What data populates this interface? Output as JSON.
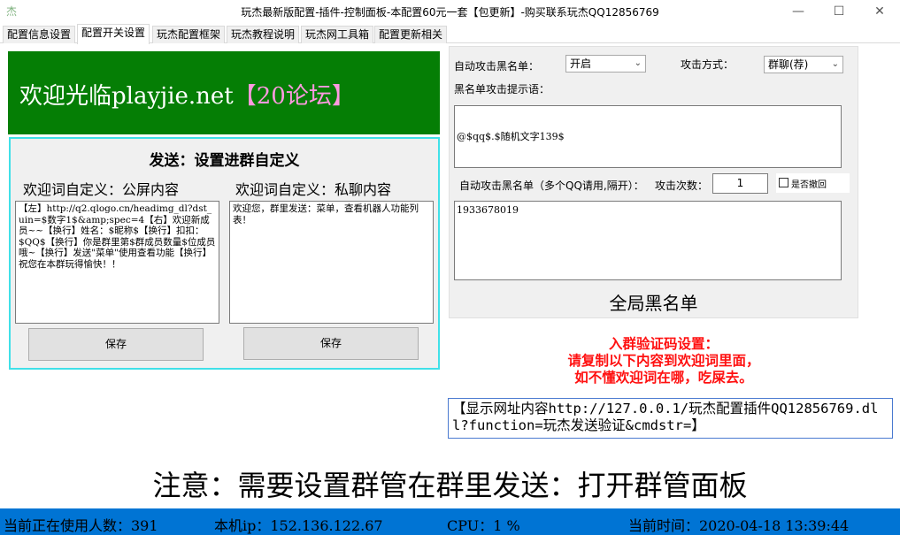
{
  "window": {
    "title": "玩杰最新版配置-插件-控制面板-本配置60元一套【包更新】-购买联系玩杰QQ12856769",
    "app_icon": "杰"
  },
  "tabs": [
    {
      "label": "配置信息设置",
      "active": false
    },
    {
      "label": "配置开关设置",
      "active": true
    },
    {
      "label": "玩杰配置框架",
      "active": false
    },
    {
      "label": "玩杰教程说明",
      "active": false
    },
    {
      "label": "玩杰网工具箱",
      "active": false
    },
    {
      "label": "配置更新相关",
      "active": false
    }
  ],
  "banner": {
    "text_main": "欢迎光临playjie.net",
    "text_pink": "【20论坛】",
    "bg_color": "#057e05"
  },
  "send_panel": {
    "title": "发送：设置进群自定义",
    "public_label": "欢迎词自定义：公屏内容",
    "private_label": "欢迎词自定义：私聊内容",
    "public_content": "【左】http://q2.qlogo.cn/headimg_dl?dst_uin=$数字1$&amp;spec=4【右】欢迎新成员~~【换行】姓名：$昵称$【换行】扣扣：$QQ$【换行】你是群里第$群成员数量$位成员哦~【换行】发送\"菜单\"使用查看功能【换行】祝您在本群玩得愉快！！",
    "private_content": "欢迎您，群里发送：菜单，查看机器人功能列表！",
    "save_left": "保存",
    "save_right": "保存"
  },
  "right_panel": {
    "auto_attack_label": "自动攻击黑名单：",
    "auto_attack_value": "开启",
    "attack_mode_label": "攻击方式：",
    "attack_mode_value": "群聊(荐)",
    "tip_label": "黑名单攻击提示语：",
    "tip_content": "@$qq$.$随机文字139$",
    "blacklist_label": "自动攻击黑名单（多个QQ请用,隔开）：",
    "attack_count_label": "攻击次数：",
    "attack_count_value": "1",
    "recall_label": "是否撤回",
    "blacklist_content": "1933678019",
    "global_label": "全局黑名单"
  },
  "verify": {
    "line1": "入群验证码设置：",
    "line2": "请复制以下内容到欢迎词里面，",
    "line3": "如不懂欢迎词在哪，吃屎去。",
    "content": "【显示网址内容http://127.0.0.1/玩杰配置插件QQ12856769.dll?function=玩杰发送验证&cmdstr=】",
    "color": "#ff1010"
  },
  "notice": "注意：需要设置群管在群里发送：打开群管面板",
  "status": {
    "users": "当前正在使用人数：391",
    "ip": "本机ip：152.136.122.67",
    "cpu": "CPU：1 %",
    "time": "当前时间：2020-04-18 13:39:44",
    "bg_color": "#0074d4"
  }
}
